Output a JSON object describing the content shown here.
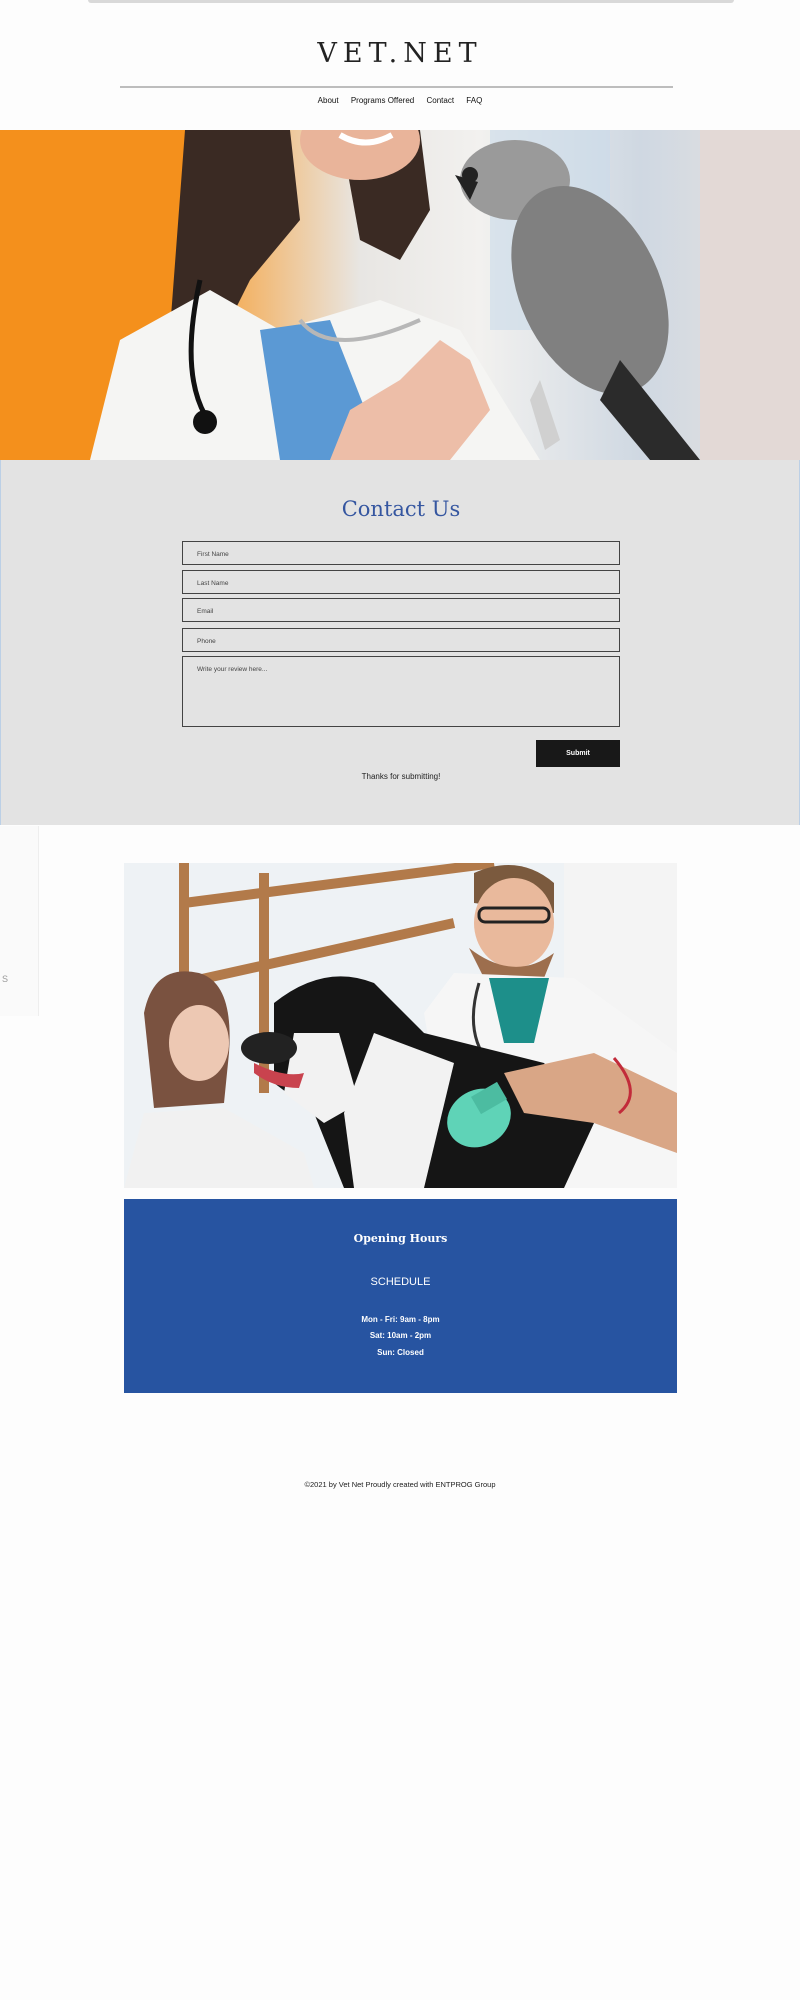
{
  "site": {
    "title": "VET.NET"
  },
  "nav": {
    "items": [
      "About",
      "Programs Offered",
      "Contact",
      "FAQ"
    ]
  },
  "contact": {
    "title": "Contact Us",
    "fields": {
      "first_name": "First Name",
      "last_name": "Last Name",
      "email": "Email",
      "phone": "Phone",
      "review": "Write your review here..."
    },
    "submit_label": "Submit",
    "thanks": "Thanks for submitting!"
  },
  "side_widget": {
    "label": "S"
  },
  "hours": {
    "title": "Opening Hours",
    "schedule_label": "SCHEDULE",
    "lines": [
      "Mon - Fri: 9am - 8pm",
      "Sat: 10am - 2pm",
      "Sun: Closed"
    ]
  },
  "footer": {
    "text": "©2021 by Vet Net Proudly created with ENTPROG Group"
  },
  "colors": {
    "accent_blue": "#2754a1",
    "contact_bg": "#e3e3e3",
    "button_bg": "#181818"
  }
}
